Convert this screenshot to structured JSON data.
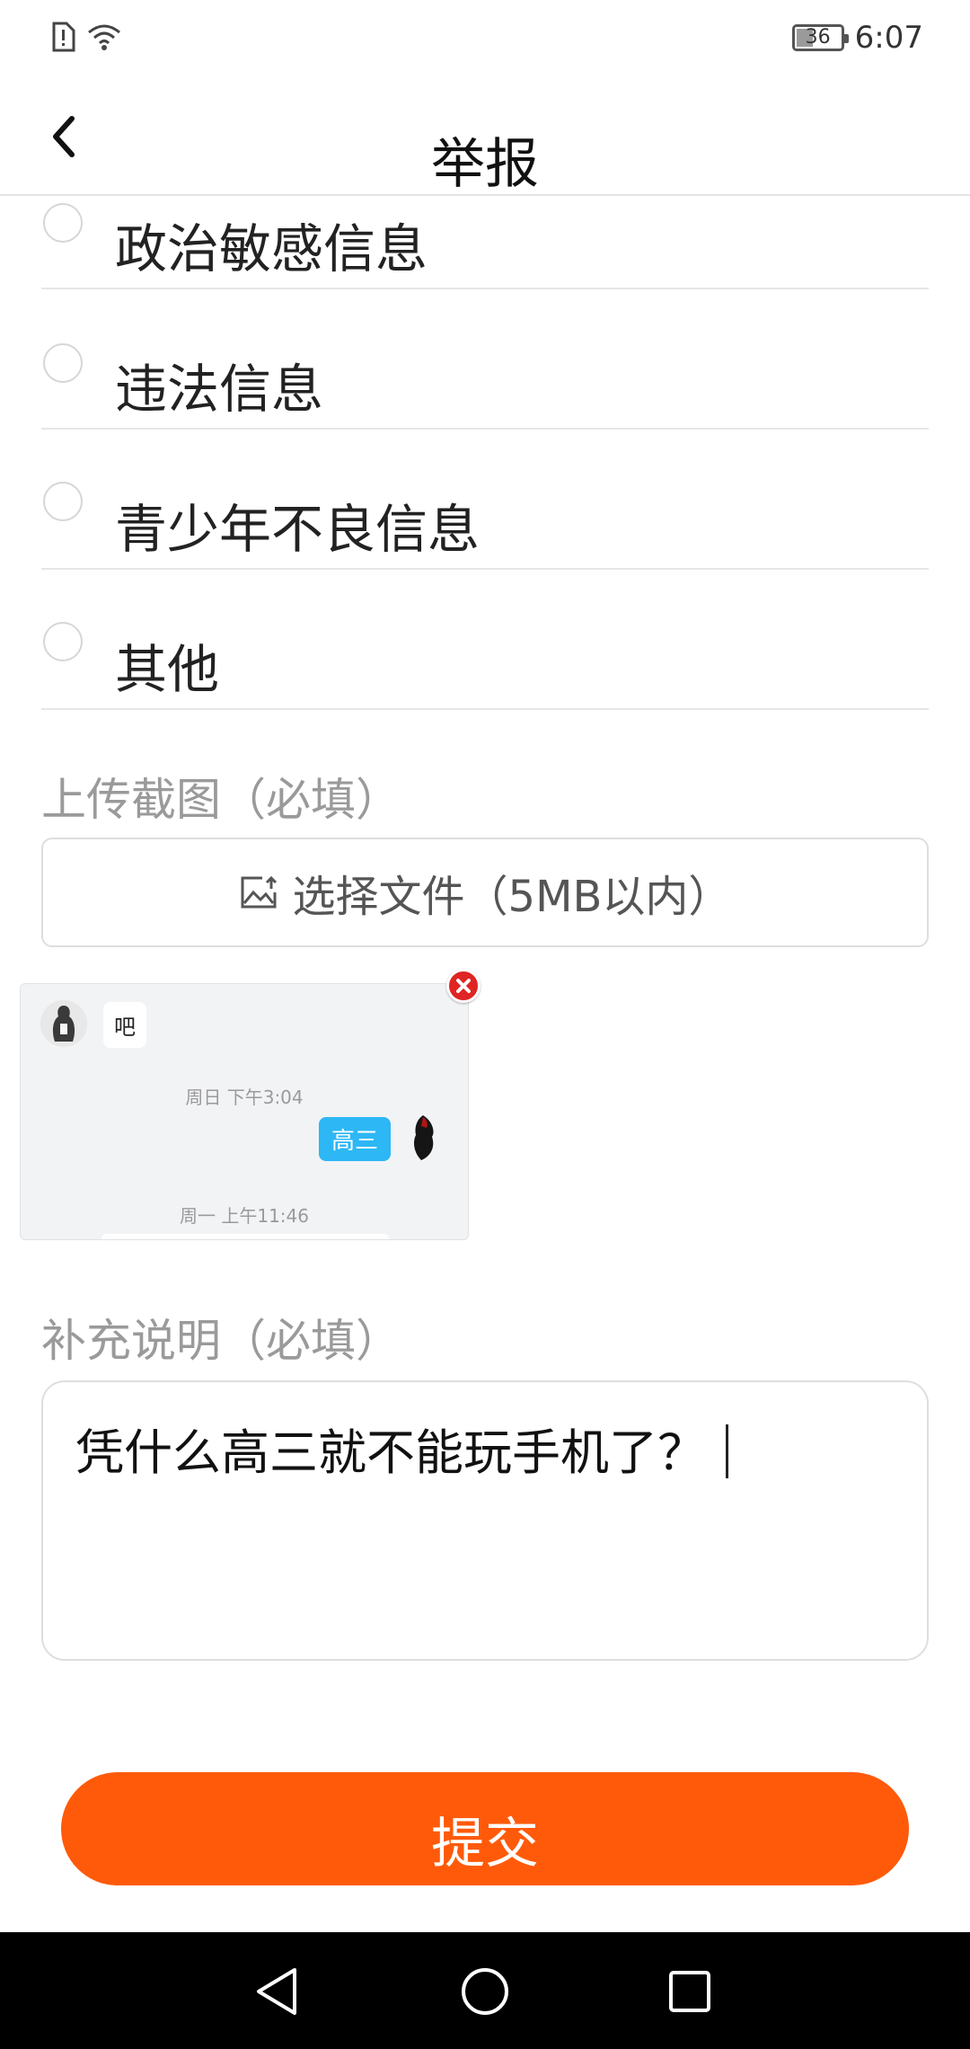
{
  "status_bar": {
    "battery": "36",
    "time": "6:07"
  },
  "header": {
    "title": "举报"
  },
  "options": [
    {
      "label": "政治敏感信息"
    },
    {
      "label": "违法信息"
    },
    {
      "label": "青少年不良信息"
    },
    {
      "label": "其他"
    }
  ],
  "upload": {
    "label": "上传截图（必填）",
    "button_label": "选择文件（5MB以内）"
  },
  "screenshot_preview": {
    "message_left": "吧",
    "time_1": "周日 下午3:04",
    "message_right": "高三",
    "time_2": "周一 上午11:46"
  },
  "description": {
    "label": "补充说明（必填）",
    "value": "凭什么高三就不能玩手机了？"
  },
  "submit_label": "提交",
  "colors": {
    "accent": "#ff5a0a",
    "chat_bubble": "#2db7f5",
    "remove": "#e02424"
  }
}
